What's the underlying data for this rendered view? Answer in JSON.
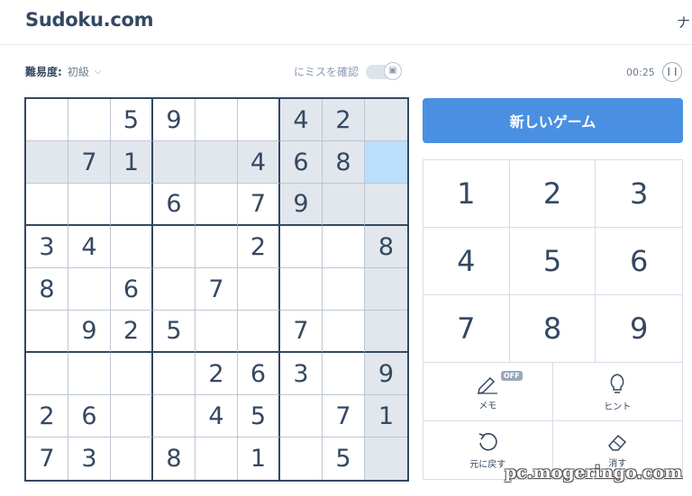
{
  "header": {
    "logo": "Sudoku.com",
    "cut_text": "ナ"
  },
  "controls": {
    "difficulty_label": "難易度:",
    "difficulty_value": "初級",
    "mistake_check_label": "にミスを確認",
    "timer": "00:25"
  },
  "board": {
    "rows": [
      [
        "",
        "",
        "5",
        "9",
        "",
        "",
        "4",
        "2",
        ""
      ],
      [
        "",
        "7",
        "1",
        "",
        "",
        "4",
        "6",
        "8",
        ""
      ],
      [
        "",
        "",
        "",
        "6",
        "",
        "7",
        "9",
        "",
        ""
      ],
      [
        "3",
        "4",
        "",
        "",
        "",
        "2",
        "",
        "",
        "8"
      ],
      [
        "8",
        "",
        "6",
        "",
        "7",
        "",
        "",
        "",
        ""
      ],
      [
        "",
        "9",
        "2",
        "5",
        "",
        "",
        "7",
        "",
        ""
      ],
      [
        "",
        "",
        "",
        "",
        "2",
        "6",
        "3",
        "",
        "9"
      ],
      [
        "2",
        "6",
        "",
        "",
        "4",
        "5",
        "",
        "7",
        "1"
      ],
      [
        "7",
        "3",
        "",
        "8",
        "",
        "1",
        "",
        "5",
        ""
      ]
    ],
    "selected": {
      "row": 1,
      "col": 8
    }
  },
  "new_game_label": "新しいゲーム",
  "numpad": [
    "1",
    "2",
    "3",
    "4",
    "5",
    "6",
    "7",
    "8",
    "9"
  ],
  "tools": {
    "memo_label": "メモ",
    "memo_badge": "OFF",
    "hint_label": "ヒント",
    "undo_label": "元に戻す",
    "erase_label": "消す"
  },
  "watermark": "pc.mogeringo.com",
  "colors": {
    "accent": "#4a90e2",
    "selected": "#bbdefb",
    "highlight": "#e2e7ed",
    "text": "#344861"
  }
}
